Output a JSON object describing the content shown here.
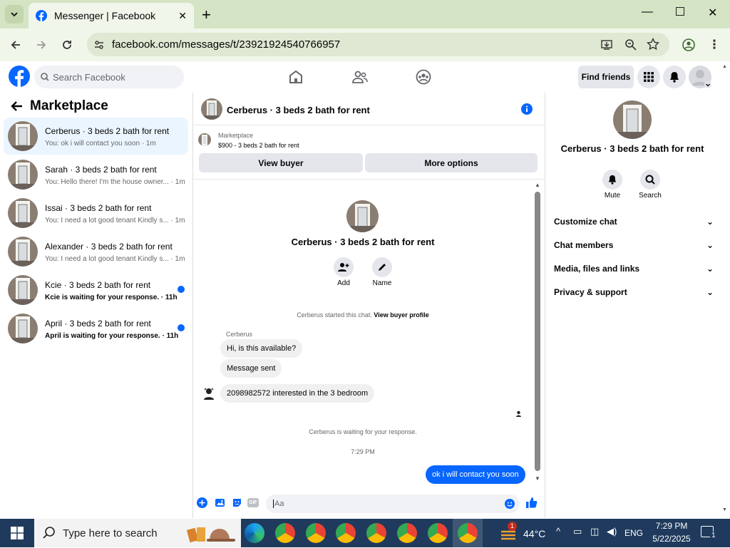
{
  "browser": {
    "tab_title": "Messenger | Facebook",
    "url": "facebook.com/messages/t/23921924540766957"
  },
  "fb": {
    "search_placeholder": "Search Facebook",
    "find_friends": "Find friends"
  },
  "sidebar": {
    "title": "Marketplace",
    "conversations": [
      {
        "name": "Cerberus · 3 beds 2 bath for rent",
        "preview": "You: ok i will contact you soon · 1m",
        "unread": false,
        "active": true
      },
      {
        "name": "Sarah · 3 beds 2 bath for rent",
        "preview": "You: Hello there! I'm the house owner... · 1m",
        "unread": false,
        "active": false
      },
      {
        "name": "Issai · 3 beds 2 bath for rent",
        "preview": "You: I need a lot good tenant Kindly s... · 1m",
        "unread": false,
        "active": false
      },
      {
        "name": "Alexander · 3 beds 2 bath for rent",
        "preview": "You: I need a lot good tenant Kindly s... · 1m",
        "unread": false,
        "active": false
      },
      {
        "name": "Kcie · 3 beds 2 bath for rent",
        "preview": "Kcie is waiting for your response. · 11h",
        "unread": true,
        "active": false
      },
      {
        "name": "April · 3 beds 2 bath for rent",
        "preview": "April is waiting for your response. · 11h",
        "unread": true,
        "active": false
      }
    ]
  },
  "chat": {
    "title": "Cerberus · 3 beds 2 bath for rent",
    "marketplace_label": "Marketplace",
    "listing": "$900 - 3 beds 2 bath for rent",
    "view_buyer": "View buyer",
    "more_options": "More options",
    "profile_name": "Cerberus · 3 beds 2 bath for rent",
    "add_label": "Add",
    "name_label": "Name",
    "started_text": "Cerberus started this chat.",
    "view_buyer_profile": "View buyer profile",
    "sender_name": "Cerberus",
    "messages": [
      {
        "text": "Hi, is this available?",
        "from_me": false
      },
      {
        "text": "Message sent",
        "from_me": false
      },
      {
        "text": "2098982572 interested in the 3 bedroom",
        "from_me": false
      },
      {
        "text": "ok i will contact you soon",
        "from_me": true
      }
    ],
    "waiting_text": "Cerberus is waiting for your response.",
    "time": "7:29 PM",
    "composer_placeholder": "Aa"
  },
  "details": {
    "name": "Cerberus · 3 beds 2 bath for rent",
    "mute": "Mute",
    "search": "Search",
    "sections": [
      "Customize chat",
      "Chat members",
      "Media, files and links",
      "Privacy & support"
    ]
  },
  "taskbar": {
    "search_placeholder": "Type here to search",
    "temperature": "44°C",
    "weather_badge": "1",
    "language": "ENG",
    "time": "7:29 PM",
    "date": "5/22/2025",
    "notifications": "1"
  },
  "colors": {
    "accent": "#0866ff",
    "tabbar": "#d5e4c4",
    "taskbar": "#1f3a5c"
  }
}
